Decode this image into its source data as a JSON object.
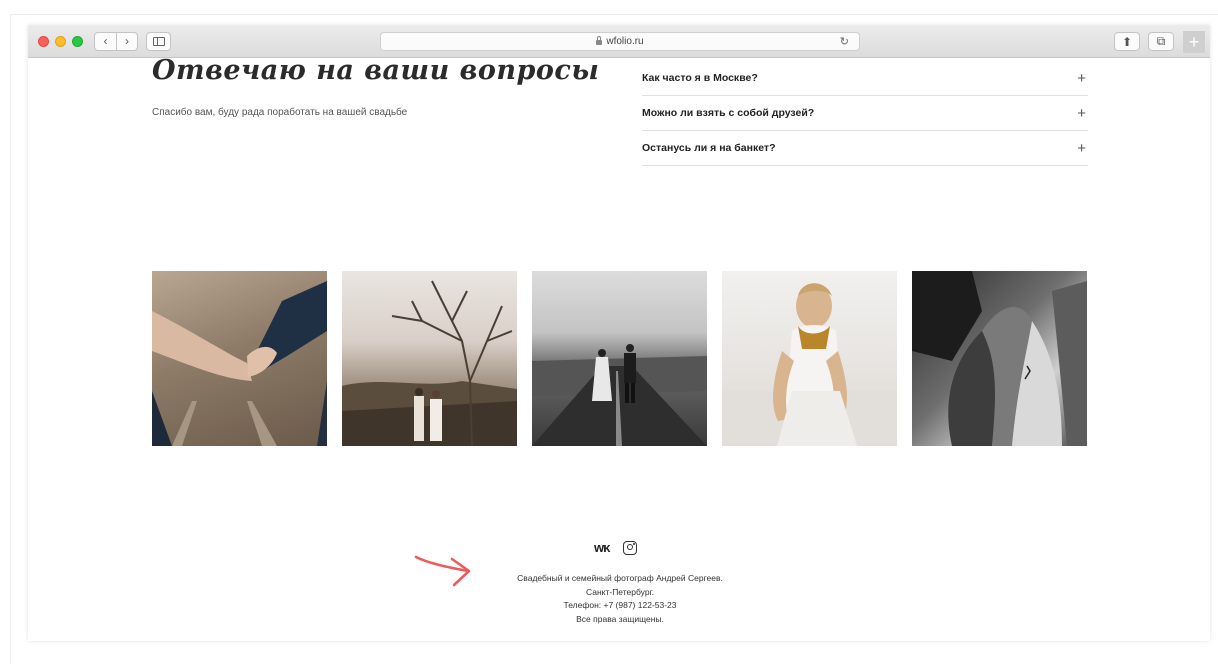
{
  "browser": {
    "url": "wfolio.ru",
    "back_glyph": "‹",
    "forward_glyph": "›",
    "reload_glyph": "↻",
    "share_glyph": "⬆",
    "tabs_glyph": "⧉",
    "new_tab_glyph": "+"
  },
  "faq": {
    "title": "Отвечаю на ваши вопросы",
    "subtitle": "Спасибо вам, буду рада поработать на вашей свадьбе",
    "items": [
      {
        "question": "Как часто я в Москве?",
        "toggle": "+"
      },
      {
        "question": "Можно ли взять с собой друзей?",
        "toggle": "+"
      },
      {
        "question": "Останусь ли я на банкет?",
        "toggle": "+"
      }
    ]
  },
  "footer": {
    "vk_label": "ᴡᴋ",
    "line1": "Свадебный и семейный фотограф Андрей Сергеев.",
    "line2": "Санкт-Петербург.",
    "line3": "Телефон: +7 (987) 122-53-23",
    "line4": "Все права защищены."
  },
  "icons": [
    "lock-icon",
    "reload-icon",
    "share-icon",
    "tabs-icon",
    "vk-icon",
    "instagram-icon",
    "arrow-annotation-icon"
  ],
  "colors": {
    "accent_arrow": "#ef5a5a",
    "traffic_red": "#fc5f57",
    "traffic_yellow": "#fdbc2e",
    "traffic_green": "#28c840"
  }
}
